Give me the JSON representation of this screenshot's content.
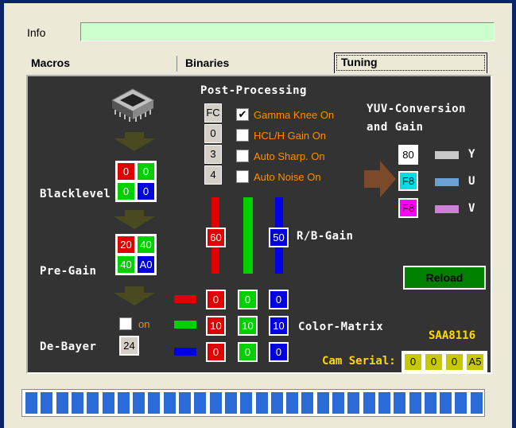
{
  "info": {
    "label": "Info",
    "value": ""
  },
  "tabs": [
    {
      "label": "Macros"
    },
    {
      "label": "Binaries"
    },
    {
      "label": "Tuning"
    }
  ],
  "pipeline": {
    "blacklevel_label": "Blacklevel",
    "blacklevel": [
      "0",
      "0",
      "0",
      "0"
    ],
    "pregain_label": "Pre-Gain",
    "pregain": [
      "20",
      "40",
      "40",
      "A0"
    ],
    "debayer_label": "De-Bayer",
    "debayer_on_label": "on",
    "debayer_value": "24"
  },
  "postprocessing": {
    "title": "Post-Processing",
    "options": [
      {
        "code": "FC",
        "label": "Gamma Knee On",
        "checked": true
      },
      {
        "code": "0",
        "label": "HCL/H Gain On",
        "checked": false
      },
      {
        "code": "3",
        "label": "Auto Sharp. On",
        "checked": false
      },
      {
        "code": "4",
        "label": "Auto Noise On",
        "checked": false
      }
    ],
    "check_mark": "✔"
  },
  "rb_gain": {
    "label": "R/B-Gain",
    "red": "60",
    "blue": "50"
  },
  "color_matrix": {
    "label": "Color-Matrix",
    "rows": [
      [
        "0",
        "0",
        "0"
      ],
      [
        "10",
        "10",
        "10"
      ],
      [
        "0",
        "0",
        "0"
      ]
    ]
  },
  "yuv": {
    "title_line1": "YUV-Conversion",
    "title_line2": "and Gain",
    "values": [
      "80",
      "F8",
      "F8"
    ],
    "channels": [
      "Y",
      "U",
      "V"
    ]
  },
  "reload_label": "Reload",
  "chip_label": "SAA8116",
  "cam_serial": {
    "label": "Cam Serial:",
    "values": [
      "0",
      "0",
      "0",
      "A5"
    ]
  },
  "progress": {
    "segments": 30,
    "fill": 1.0
  },
  "colors": {
    "panel": "#333333",
    "info_field": "#ccffcc",
    "progress": "#2a6bd8",
    "reload": "#008000",
    "serial": "#c8c800"
  }
}
